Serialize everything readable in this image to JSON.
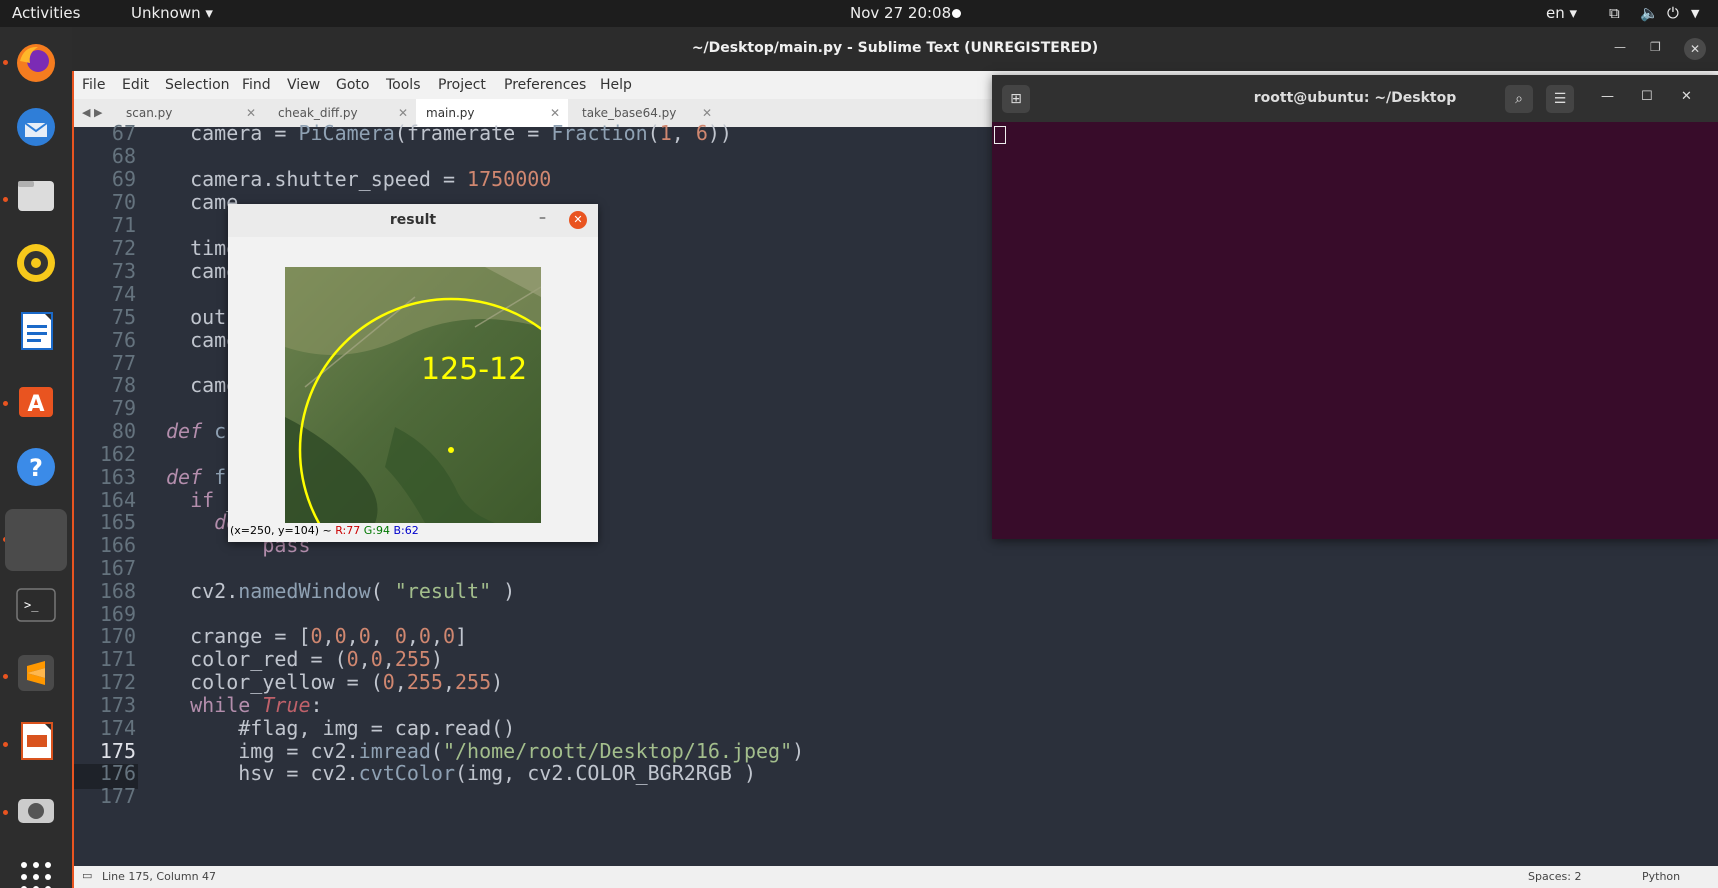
{
  "topbar": {
    "activities": "Activities",
    "app_menu": "Unknown ▾",
    "clock": "Nov 27  20:08",
    "language": "en ▾"
  },
  "dock": {
    "items": [
      "firefox-icon",
      "thunderbird-icon",
      "files-icon",
      "rhythmbox-icon",
      "libreoffice-writer-icon",
      "software-icon",
      "help-icon",
      "blank-app-icon",
      "terminal-icon",
      "sublime-icon",
      "impress-icon",
      "camera-icon",
      "show-apps-icon"
    ]
  },
  "sublime": {
    "title": "~/Desktop/main.py - Sublime Text (UNREGISTERED)",
    "menu": [
      "File",
      "Edit",
      "Selection",
      "Find",
      "View",
      "Goto",
      "Tools",
      "Project",
      "Preferences",
      "Help"
    ],
    "tabs": [
      {
        "label": "scan.py",
        "active": false
      },
      {
        "label": "cheak_diff.py",
        "active": false
      },
      {
        "label": "main.py",
        "active": true
      },
      {
        "label": "take_base64.py",
        "active": false
      }
    ],
    "line_numbers": [
      "67",
      "68",
      "69",
      "70",
      "71",
      "72",
      "73",
      "74",
      "75",
      "76",
      "77",
      "78",
      "79",
      "80",
      "162",
      "163",
      "164",
      "165",
      "166",
      "167",
      "168",
      "169",
      "170",
      "171",
      "172",
      "173",
      "174",
      "175",
      "176",
      "177"
    ],
    "status": {
      "position": "Line 175, Column 47",
      "spaces": "Spaces: 2",
      "syntax": "Python"
    }
  },
  "result_window": {
    "title": "result",
    "overlay_text": "125-12",
    "pixel_info_prefix": "(x=250, y=104) ~",
    "pixel_r": "R:77",
    "pixel_g": "G:94",
    "pixel_b": "B:62"
  },
  "terminal": {
    "title": "roott@ubuntu: ~/Desktop"
  }
}
